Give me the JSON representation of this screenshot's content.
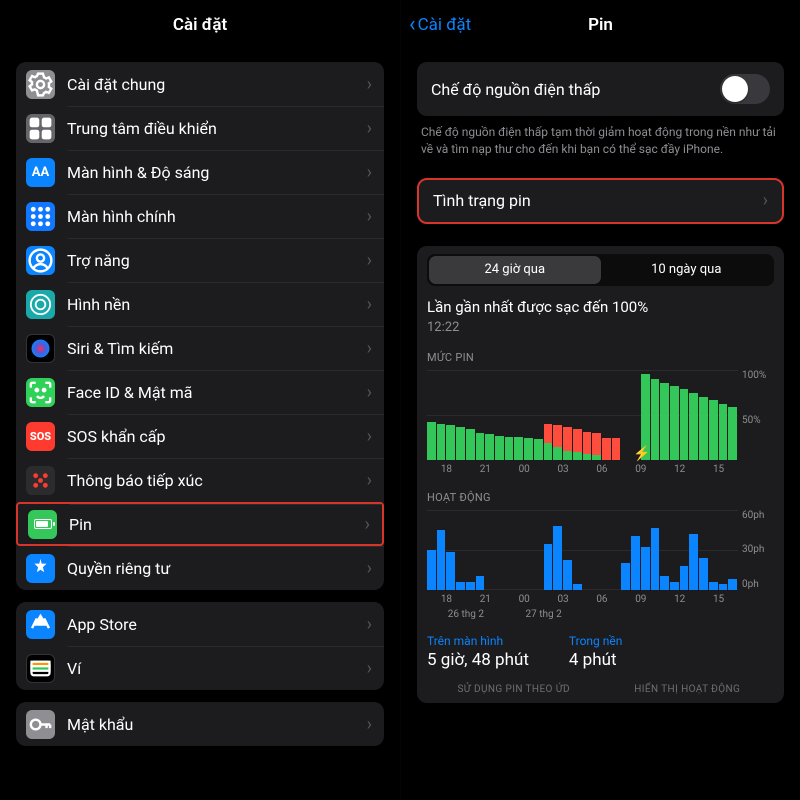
{
  "left": {
    "title": "Cài đặt",
    "groups": [
      [
        {
          "key": "general",
          "label": "Cài đặt chung",
          "icon": "gear",
          "color": "ic-gray"
        },
        {
          "key": "control-center",
          "label": "Trung tâm điều khiển",
          "icon": "sliders",
          "color": "ic-gray2"
        },
        {
          "key": "display",
          "label": "Màn hình & Độ sáng",
          "icon": "aa",
          "color": "ic-blue"
        },
        {
          "key": "home-screen",
          "label": "Màn hình chính",
          "icon": "grid",
          "color": "ic-blue2"
        },
        {
          "key": "accessibility",
          "label": "Trợ năng",
          "icon": "person",
          "color": "ic-blue3"
        },
        {
          "key": "wallpaper",
          "label": "Hình nền",
          "icon": "wall",
          "color": "ic-cyan"
        },
        {
          "key": "siri",
          "label": "Siri & Tìm kiếm",
          "icon": "siri",
          "color": "ic-black"
        },
        {
          "key": "faceid",
          "label": "Face ID & Mật mã",
          "icon": "face",
          "color": "ic-green"
        },
        {
          "key": "sos",
          "label": "SOS khẩn cấp",
          "icon": "sos",
          "color": "ic-red"
        },
        {
          "key": "exposure",
          "label": "Thông báo tiếp xúc",
          "icon": "expo",
          "color": "ic-pinkish"
        },
        {
          "key": "battery",
          "label": "Pin",
          "icon": "batt",
          "color": "ic-green2",
          "highlight": true
        },
        {
          "key": "privacy",
          "label": "Quyền riêng tư",
          "icon": "hand",
          "color": "ic-hand"
        }
      ],
      [
        {
          "key": "appstore",
          "label": "App Store",
          "icon": "store",
          "color": "ic-store"
        },
        {
          "key": "wallet",
          "label": "Ví",
          "icon": "wallet",
          "color": "ic-wallet"
        }
      ],
      [
        {
          "key": "passwords",
          "label": "Mật khẩu",
          "icon": "key",
          "color": "ic-key"
        }
      ]
    ]
  },
  "right": {
    "back": "Cài đặt",
    "title": "Pin",
    "lowpower_label": "Chế độ nguồn điện thấp",
    "lowpower_on": false,
    "footnote": "Chế độ nguồn điện thấp tạm thời giảm hoạt động trong nền như tải về và tìm nạp thư cho đến khi bạn có thể sạc đầy iPhone.",
    "battery_health_label": "Tình trạng pin",
    "seg": {
      "a": "24 giờ qua",
      "b": "10 ngày qua",
      "selected": "a"
    },
    "last_charge_label": "Lần gần nhất được sạc đến 100%",
    "last_charge_time": "12:22",
    "level_title": "MỨC PIN",
    "activity_title": "HOẠT ĐỘNG",
    "y_level": [
      "100%",
      "50%"
    ],
    "y_activity": [
      "60ph",
      "30ph",
      "0ph"
    ],
    "x_hours": [
      "18",
      "21",
      "00",
      "03",
      "06",
      "09",
      "12",
      "15"
    ],
    "x_dates": [
      "26 thg 2",
      "27 thg 2"
    ],
    "usage": {
      "screen_label": "Trên màn hình",
      "screen_value": "5 giờ, 48 phút",
      "bg_label": "Trong nền",
      "bg_value": "4 phút"
    },
    "tabs": {
      "a": "SỬ DỤNG PIN THEO ỨD",
      "b": "HIỂN THỊ HOẠT ĐỘNG"
    }
  },
  "chart_data": {
    "type": "bar",
    "level": {
      "x_hours": [
        "18",
        "21",
        "00",
        "03",
        "06",
        "09",
        "12",
        "15"
      ],
      "ylim": [
        0,
        100
      ],
      "series": [
        {
          "name": "green",
          "values": [
            42,
            40,
            38,
            36,
            34,
            30,
            28,
            26,
            25,
            25,
            24,
            23,
            18,
            14,
            10,
            8,
            6,
            5,
            0,
            0,
            0,
            0,
            95,
            90,
            85,
            82,
            78,
            74,
            70,
            66,
            62,
            58
          ]
        },
        {
          "name": "red",
          "values": [
            0,
            0,
            0,
            0,
            0,
            0,
            0,
            0,
            0,
            0,
            0,
            0,
            22,
            24,
            26,
            26,
            25,
            25,
            24,
            24,
            0,
            0,
            0,
            0,
            0,
            0,
            0,
            0,
            0,
            0,
            0,
            0
          ]
        }
      ],
      "charging_at_slot": 21
    },
    "activity": {
      "x_hours": [
        "18",
        "21",
        "00",
        "03",
        "06",
        "09",
        "12",
        "15"
      ],
      "ylim": [
        0,
        60
      ],
      "series": [
        {
          "name": "blue",
          "values": [
            30,
            45,
            28,
            6,
            6,
            10,
            0,
            0,
            0,
            0,
            0,
            0,
            34,
            48,
            22,
            4,
            0,
            0,
            0,
            0,
            20,
            40,
            32,
            46,
            10,
            6,
            18,
            42,
            24,
            6,
            4,
            8
          ]
        }
      ]
    }
  }
}
